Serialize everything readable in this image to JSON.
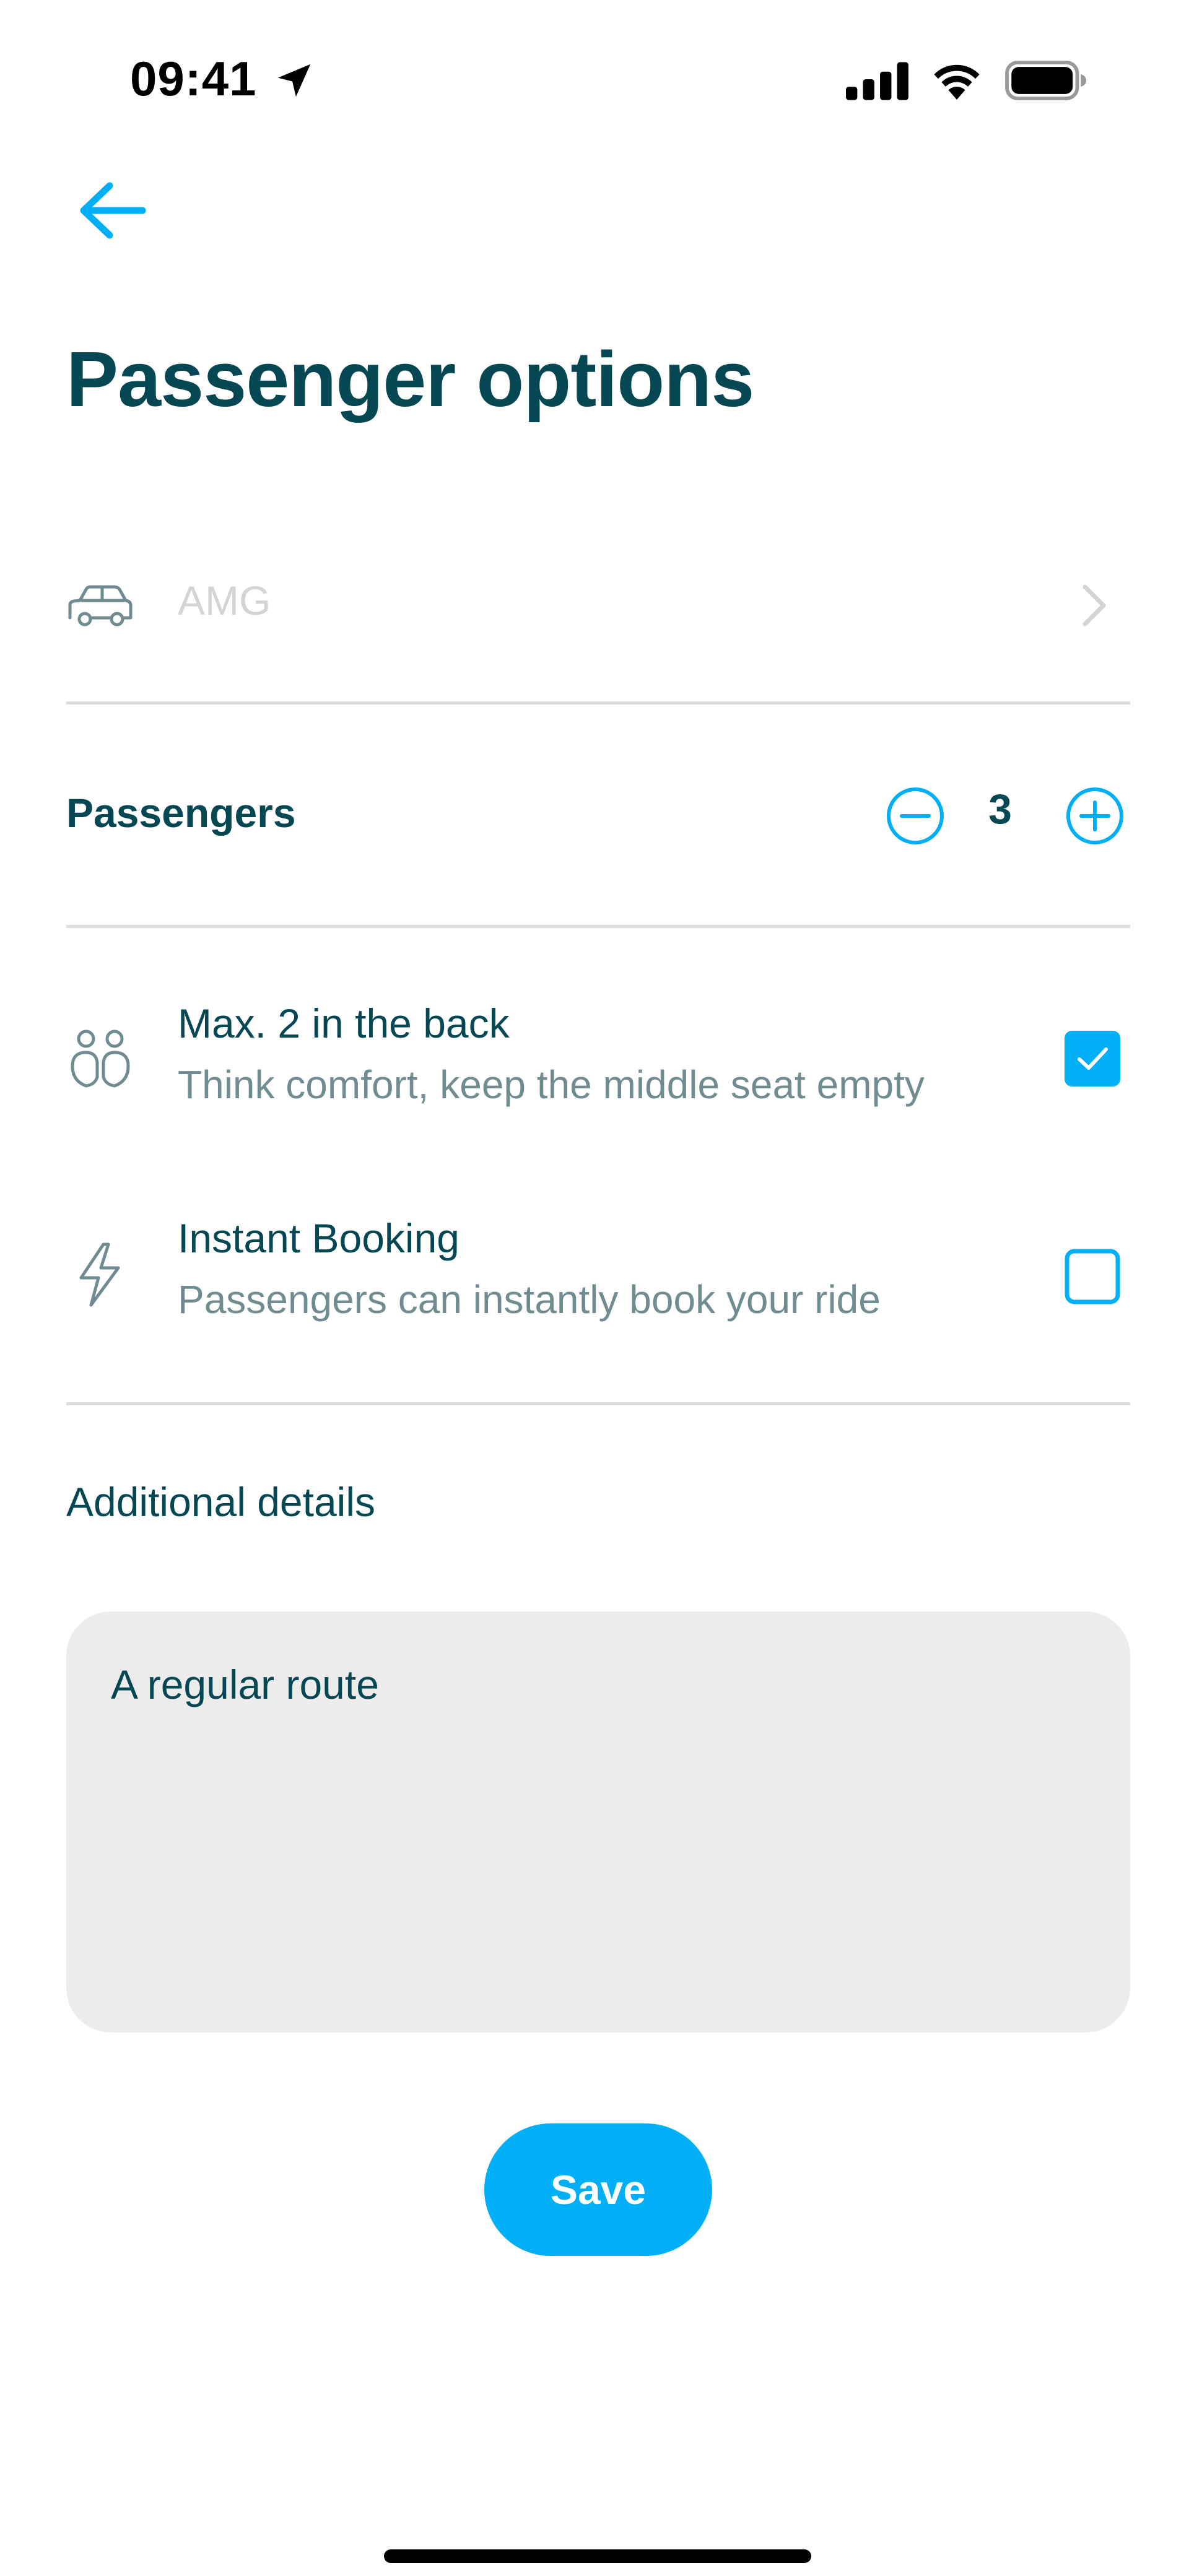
{
  "status_bar": {
    "time": "09:41",
    "icons": [
      "location-arrow-icon",
      "cellular-signal-icon",
      "wifi-icon",
      "battery-icon"
    ]
  },
  "header": {
    "back_icon": "arrow-left-icon",
    "title": "Passenger options"
  },
  "car": {
    "icon": "car-icon",
    "label": "AMG",
    "chevron_icon": "chevron-right-icon"
  },
  "passengers": {
    "label": "Passengers",
    "count": "3",
    "decrement_icon": "minus-circle-icon",
    "increment_icon": "plus-circle-icon"
  },
  "options": [
    {
      "icon": "two-passengers-icon",
      "title": "Max. 2 in the back",
      "subtitle": "Think comfort, keep the middle seat empty",
      "checked": true
    },
    {
      "icon": "lightning-icon",
      "title": "Instant Booking",
      "subtitle": "Passengers can instantly book your ride",
      "checked": false
    }
  ],
  "details": {
    "label": "Additional details",
    "value": "A regular route"
  },
  "save_label": "Save",
  "colors": {
    "primary_text": "#054752",
    "secondary_text": "#708c91",
    "accent": "#00aff5",
    "muted": "#d4d4d4",
    "field_bg": "#ececec"
  }
}
